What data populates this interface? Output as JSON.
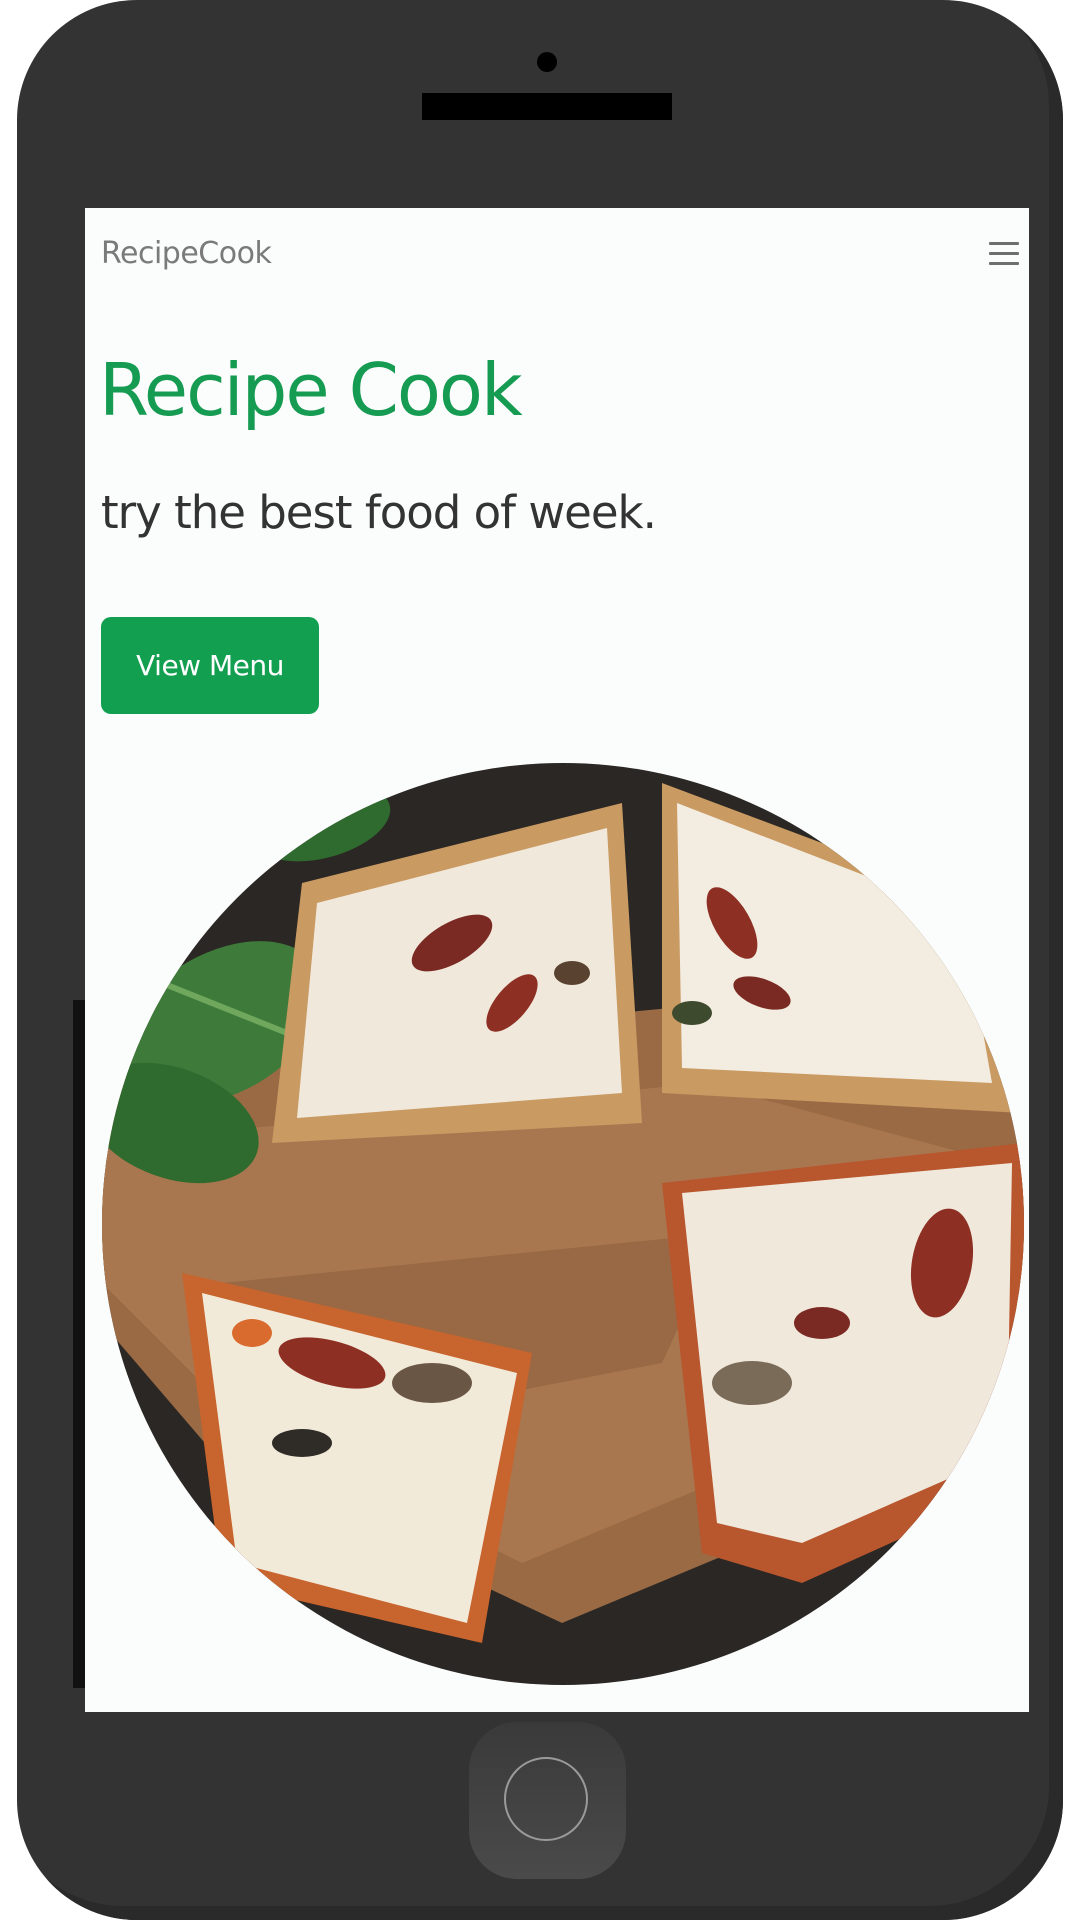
{
  "app": {
    "brand": "RecipeCook"
  },
  "navbar": {
    "menu_icon": "hamburger-icon"
  },
  "hero": {
    "title": "Recipe Cook",
    "subtitle": "try the best food of week.",
    "button_label": "View Menu"
  },
  "image": {
    "subject": "pizza-slices-on-wooden-board"
  },
  "colors": {
    "accent": "#169b52",
    "button": "#139f50",
    "device": "#333333",
    "screen_bg": "#fbfcfc"
  }
}
